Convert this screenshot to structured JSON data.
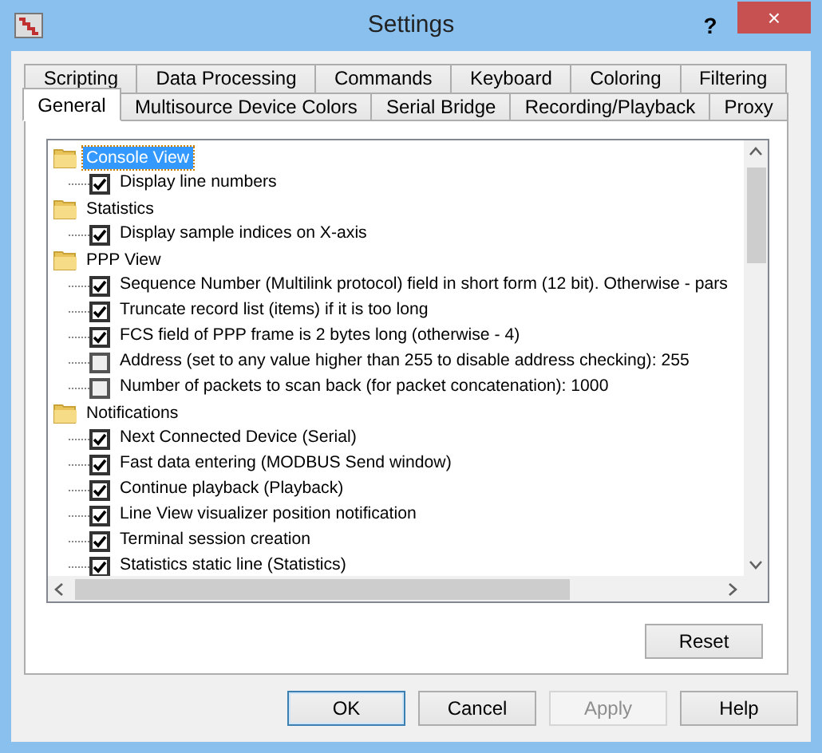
{
  "window": {
    "title": "Settings",
    "help": "?",
    "close": "×"
  },
  "tab_rows": [
    [
      {
        "label": "Scripting",
        "selected": false
      },
      {
        "label": "Data Processing",
        "selected": false
      },
      {
        "label": "Commands",
        "selected": false
      },
      {
        "label": "Keyboard",
        "selected": false
      },
      {
        "label": "Coloring",
        "selected": false
      },
      {
        "label": "Filtering",
        "selected": false
      }
    ],
    [
      {
        "label": "General",
        "selected": true
      },
      {
        "label": "Multisource Device Colors",
        "selected": false
      },
      {
        "label": "Serial Bridge",
        "selected": false
      },
      {
        "label": "Recording/Playback",
        "selected": false
      },
      {
        "label": "Proxy",
        "selected": false
      }
    ]
  ],
  "tree": [
    {
      "label": "Console View",
      "selected": true,
      "children": [
        {
          "label": "Display line numbers",
          "checked": true
        }
      ]
    },
    {
      "label": "Statistics",
      "selected": false,
      "children": [
        {
          "label": "Display sample indices on X-axis",
          "checked": true
        }
      ]
    },
    {
      "label": "PPP View",
      "selected": false,
      "children": [
        {
          "label": "Sequence Number (Multilink protocol) field in short form (12 bit). Otherwise - pars",
          "checked": true
        },
        {
          "label": "Truncate record list (items) if it is too long",
          "checked": true
        },
        {
          "label": "FCS field of PPP frame is 2 bytes long (otherwise - 4)",
          "checked": true
        },
        {
          "label": "Address (set to any value higher than 255 to disable address checking): 255",
          "checked": false
        },
        {
          "label": "Number of packets to scan back (for packet concatenation): 1000",
          "checked": false
        }
      ]
    },
    {
      "label": "Notifications",
      "selected": false,
      "children": [
        {
          "label": "Next Connected Device (Serial)",
          "checked": true
        },
        {
          "label": "Fast data entering (MODBUS Send window)",
          "checked": true
        },
        {
          "label": "Continue playback (Playback)",
          "checked": true
        },
        {
          "label": "Line View visualizer position notification",
          "checked": true
        },
        {
          "label": "Terminal session creation",
          "checked": true
        },
        {
          "label": "Statistics static line (Statistics)",
          "checked": true
        }
      ]
    }
  ],
  "reset_button": "Reset",
  "buttons": [
    {
      "label": "OK",
      "default": true,
      "disabled": false
    },
    {
      "label": "Cancel",
      "default": false,
      "disabled": false
    },
    {
      "label": "Apply",
      "default": false,
      "disabled": true
    },
    {
      "label": "Help",
      "default": false,
      "disabled": false
    }
  ]
}
